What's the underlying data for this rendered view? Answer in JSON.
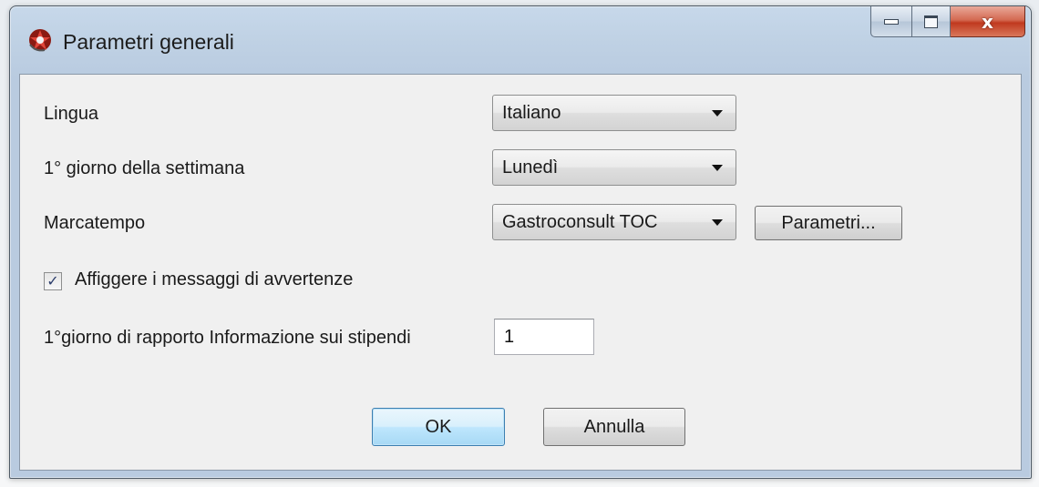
{
  "window": {
    "title": "Parametri generali",
    "close_glyph": "x"
  },
  "form": {
    "language": {
      "label": "Lingua",
      "value": "Italiano"
    },
    "first_day": {
      "label": "1° giorno della settimana",
      "value": "Lunedì"
    },
    "time_clock": {
      "label": "Marcatempo",
      "value": "Gastroconsult TOC",
      "params_button": "Parametri..."
    },
    "warnings": {
      "label": "Affiggere i messaggi di avvertenze",
      "checked": true
    },
    "salary_report": {
      "label": "1°giorno di rapporto Informazione sui stipendi",
      "value": "1"
    }
  },
  "buttons": {
    "ok": "OK",
    "cancel": "Annulla"
  },
  "icons": {
    "app": "app-logo-icon",
    "minimize": "minimize-icon",
    "maximize": "maximize-icon",
    "close": "close-icon",
    "check": "checkmark-icon"
  },
  "colors": {
    "default_button_border": "#3c7fb1",
    "close_button": "#c0391f",
    "dialog_bg": "#f0f0f0"
  }
}
